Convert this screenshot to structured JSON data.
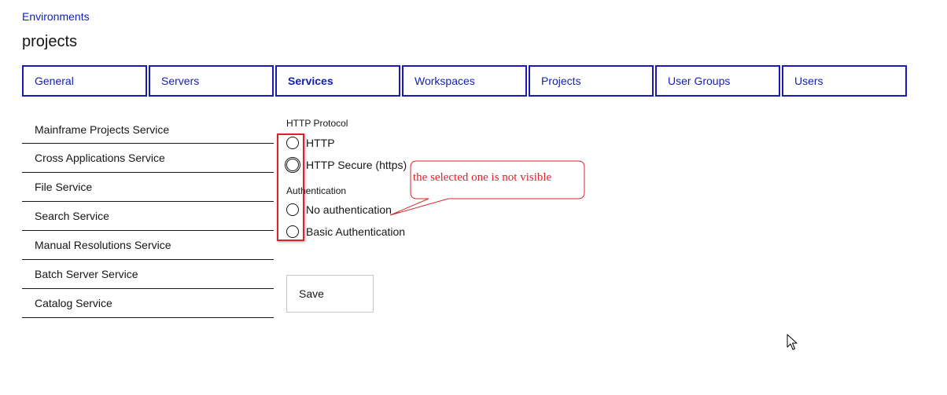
{
  "breadcrumb": {
    "label": "Environments"
  },
  "page": {
    "title": "projects"
  },
  "tabs": [
    {
      "label": "General"
    },
    {
      "label": "Servers"
    },
    {
      "label": "Services",
      "active": true
    },
    {
      "label": "Workspaces"
    },
    {
      "label": "Projects"
    },
    {
      "label": "User Groups"
    },
    {
      "label": "Users"
    }
  ],
  "services": [
    {
      "label": "Mainframe Projects Service"
    },
    {
      "label": "Cross Applications Service"
    },
    {
      "label": "File Service"
    },
    {
      "label": "Search Service"
    },
    {
      "label": "Manual Resolutions Service"
    },
    {
      "label": "Batch Server Service"
    },
    {
      "label": "Catalog Service"
    }
  ],
  "http_protocol": {
    "label": "HTTP Protocol",
    "options": [
      {
        "label": "HTTP",
        "selected": false
      },
      {
        "label": "HTTP Secure (https)",
        "selected": false
      }
    ]
  },
  "authentication": {
    "label": "Authentication",
    "options": [
      {
        "label": "No authentication",
        "selected": false
      },
      {
        "label": "Basic Authentication",
        "selected": false
      }
    ]
  },
  "actions": {
    "save_label": "Save"
  },
  "annotation": {
    "text": "the selected one is not visible"
  },
  "colors": {
    "link": "#0f1fb8",
    "tab_border": "#1a1ab8",
    "annotation_red": "#d6252b"
  }
}
